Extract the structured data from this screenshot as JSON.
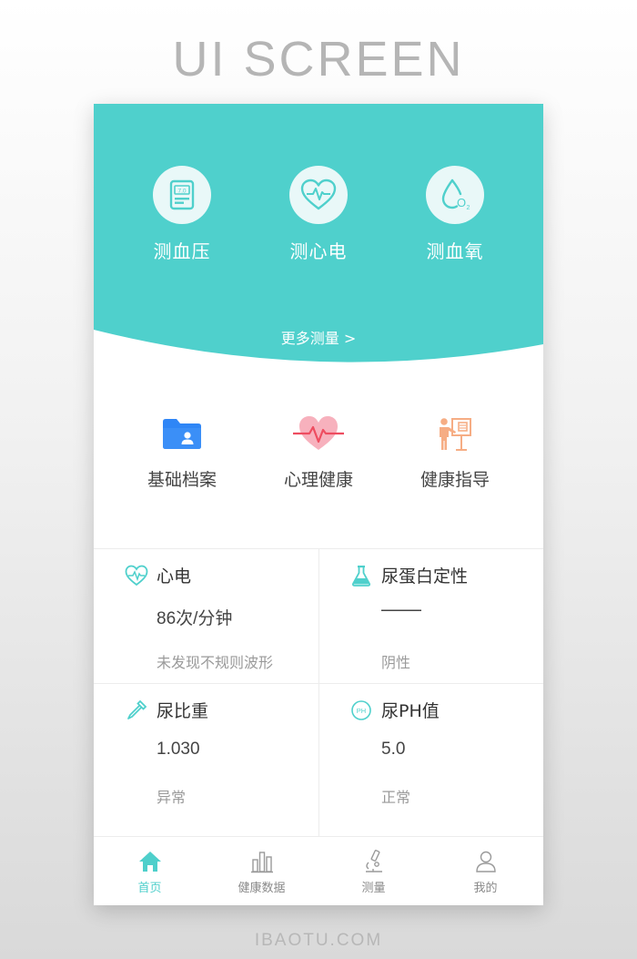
{
  "page": {
    "heading": "UI SCREEN",
    "footer": "IBAOTU.COM"
  },
  "colors": {
    "primary": "#4fd0cc",
    "icon_bg": "#e9f8f8",
    "folder_blue": "#2f86f6",
    "heart_pink": "#f7b1bd",
    "heart_red": "#ee4d60",
    "guide_orange": "#f6ad84"
  },
  "measure": {
    "items": [
      {
        "label": "测血压",
        "icon": "blood-pressure-monitor-icon",
        "display": "7.0"
      },
      {
        "label": "测心电",
        "icon": "heart-ecg-icon"
      },
      {
        "label": "测血氧",
        "icon": "oxygen-drop-icon",
        "sub": "O",
        "sub2": "2"
      }
    ],
    "more": "更多测量 >"
  },
  "features": [
    {
      "label": "基础档案",
      "icon": "profile-folder-icon"
    },
    {
      "label": "心理健康",
      "icon": "heart-pulse-icon"
    },
    {
      "label": "健康指导",
      "icon": "health-guide-icon"
    }
  ],
  "cards": [
    {
      "title": "心电",
      "value": "86次/分钟",
      "status": "未发现不规则波形",
      "icon": "heart-ecg-outline-icon"
    },
    {
      "title": "尿蛋白定性",
      "value": "——",
      "status": "阴性",
      "icon": "flask-icon"
    },
    {
      "title": "尿比重",
      "value": "1.030",
      "status": "异常",
      "icon": "dropper-icon"
    },
    {
      "title": "尿PH值",
      "value": "5.0",
      "status": "正常",
      "icon": "ph-icon",
      "icon_text": "PH"
    }
  ],
  "tabs": [
    {
      "label": "首页",
      "icon": "home-icon",
      "active": true
    },
    {
      "label": "健康数据",
      "icon": "bar-chart-icon",
      "active": false
    },
    {
      "label": "测量",
      "icon": "microscope-icon",
      "active": false
    },
    {
      "label": "我的",
      "icon": "user-icon",
      "active": false
    }
  ]
}
